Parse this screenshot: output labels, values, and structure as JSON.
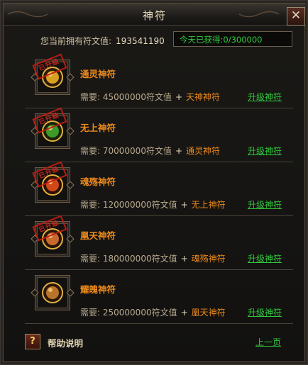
{
  "window": {
    "title": "神符",
    "close_label": "✕"
  },
  "header": {
    "points_label": "您当前拥有符文值:",
    "points_value": "193541190",
    "today_label": "今天已获得:",
    "today_value": "0/300000"
  },
  "runes": [
    {
      "name": "通灵神符",
      "stamp": "已升级",
      "owned": true,
      "req_label": "需要:",
      "cost": "45000000",
      "unit": "符文值",
      "plus": "+",
      "target": "天神神符",
      "upgrade": "升级神符",
      "color": "#d8a020"
    },
    {
      "name": "无上神符",
      "stamp": "已升级",
      "owned": true,
      "req_label": "需要:",
      "cost": "70000000",
      "unit": "符文值",
      "plus": "+",
      "target": "通灵神符",
      "upgrade": "升级神符",
      "color": "#3f9a2a"
    },
    {
      "name": "魂殇神符",
      "stamp": "已升级",
      "owned": true,
      "req_label": "需要:",
      "cost": "120000000",
      "unit": "符文值",
      "plus": "+",
      "target": "无上神符",
      "upgrade": "升级神符",
      "color": "#d04818"
    },
    {
      "name": "凰天神符",
      "stamp": "已升级",
      "owned": true,
      "req_label": "需要:",
      "cost": "180000000",
      "unit": "符文值",
      "plus": "+",
      "target": "魂殇神符",
      "upgrade": "升级神符",
      "color": "#c86a30"
    },
    {
      "name": "耀魄神符",
      "stamp": "",
      "owned": false,
      "req_label": "需要:",
      "cost": "250000000",
      "unit": "符文值",
      "plus": "+",
      "target": "凰天神符",
      "upgrade": "升级神符",
      "color": "#b8742a"
    }
  ],
  "footer": {
    "help_icon": "?",
    "help_label": "帮助说明",
    "prev_label": "上一页"
  }
}
